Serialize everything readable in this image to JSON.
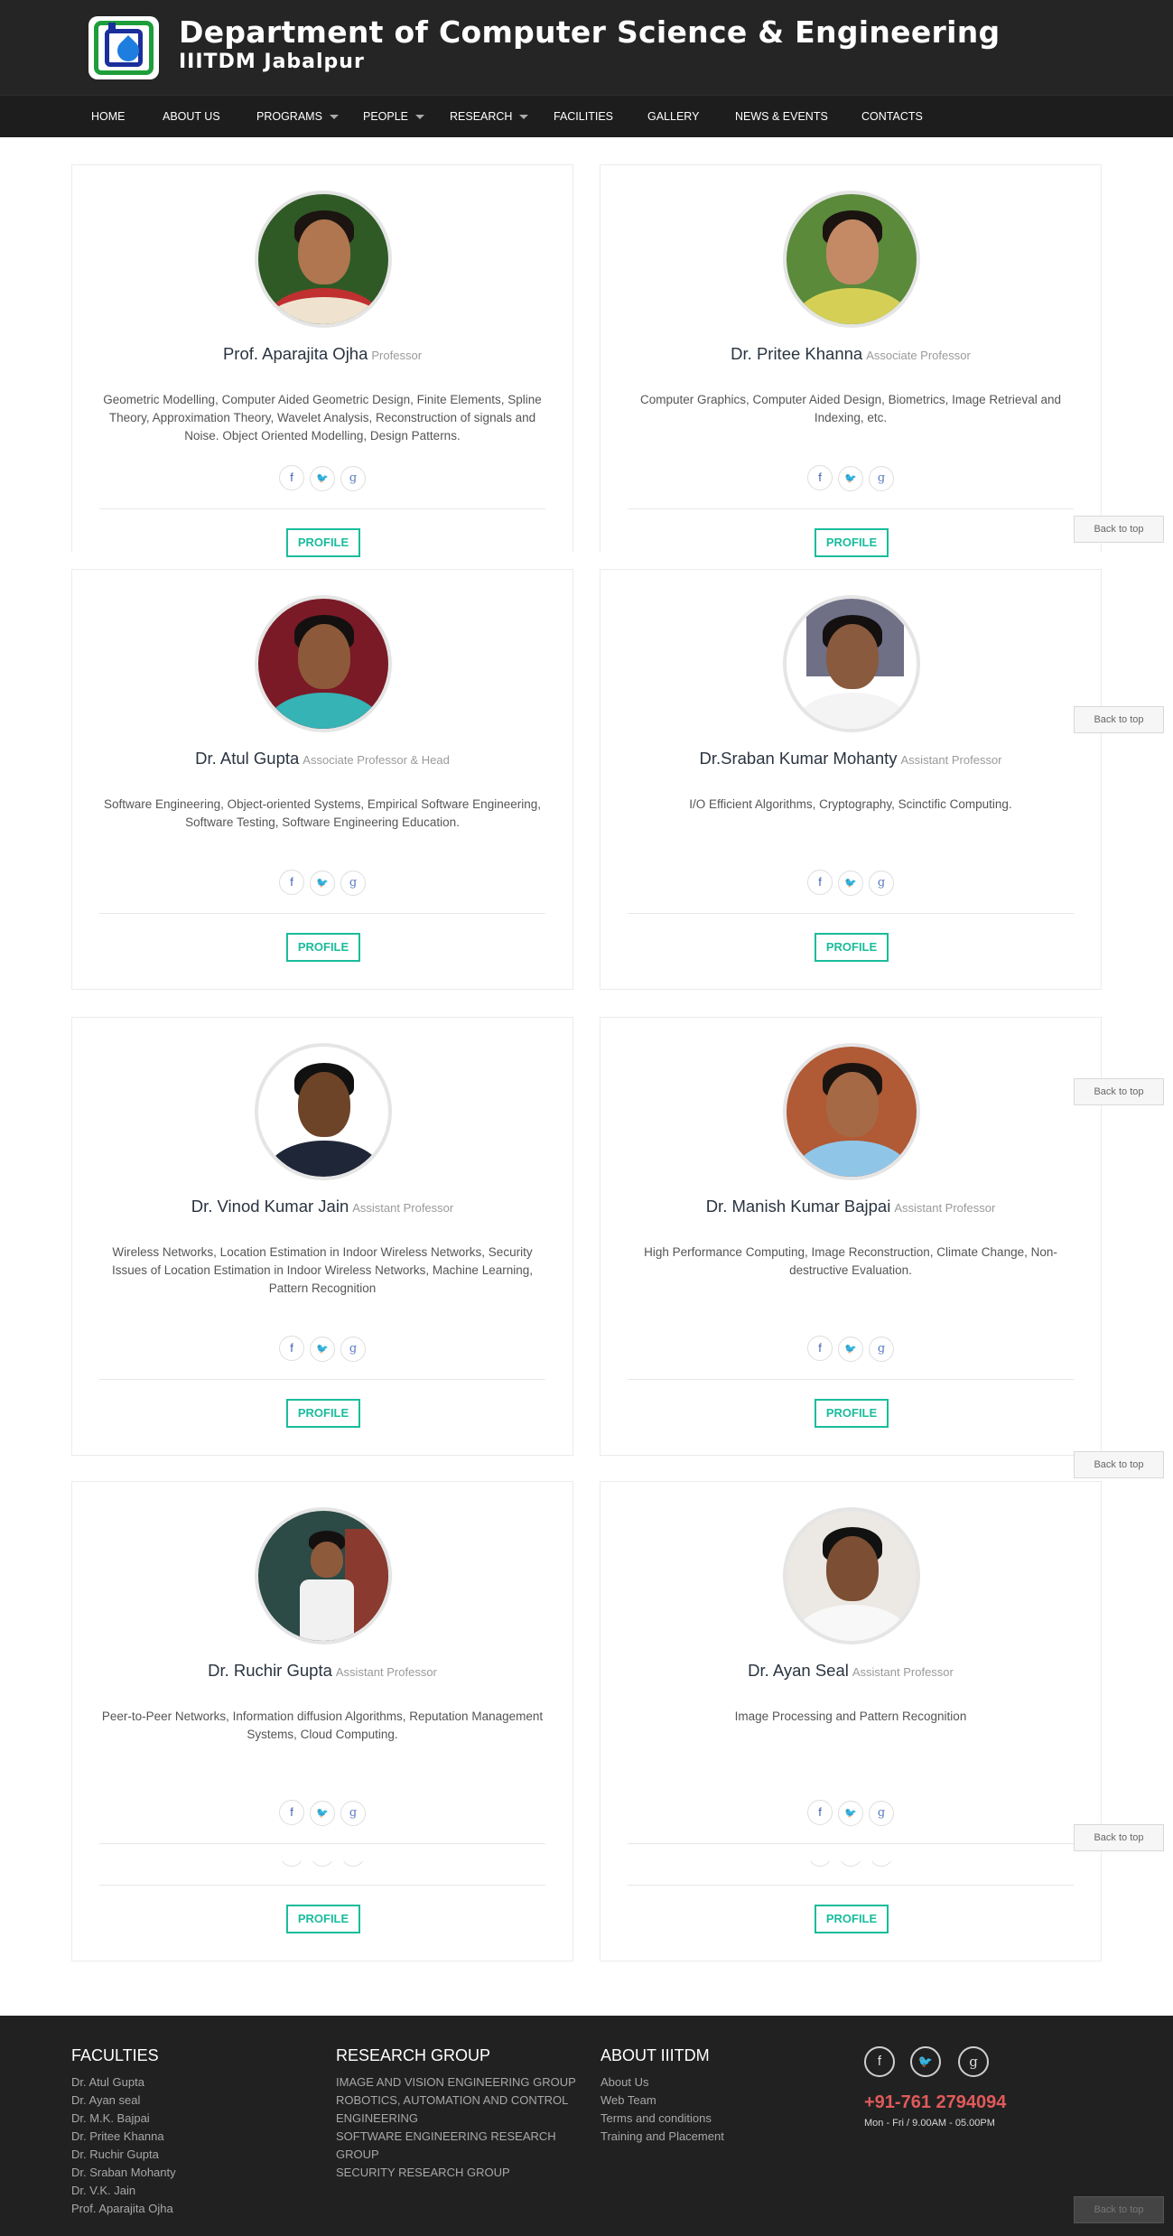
{
  "header": {
    "title": "Department of Computer Science & Engineering",
    "subtitle": "IIITDM Jabalpur"
  },
  "nav": {
    "items": [
      {
        "label": "HOME"
      },
      {
        "label": "ABOUT US"
      },
      {
        "label": "PROGRAMS",
        "dropdown": true
      },
      {
        "label": "PEOPLE",
        "dropdown": true
      },
      {
        "label": "RESEARCH",
        "dropdown": true
      },
      {
        "label": "FACILITIES"
      },
      {
        "label": "GALLERY"
      },
      {
        "label": "NEWS & EVENTS"
      },
      {
        "label": "CONTACTS"
      }
    ]
  },
  "faculty": [
    {
      "name": "Prof. Aparajita Ojha",
      "role": "Professor",
      "interests": "Geometric Modelling, Computer Aided Geometric Design, Finite Elements, Spline Theory, Approximation Theory, Wavelet Analysis, Reconstruction of signals and Noise. Object Oriented Modelling, Design Patterns."
    },
    {
      "name": "Dr. Pritee Khanna",
      "role": "Associate Professor",
      "interests": "Computer Graphics, Computer Aided Design, Biometrics, Image Retrieval and Indexing, etc."
    },
    {
      "name": "Dr. Atul Gupta",
      "role": "Associate Professor & Head",
      "interests": "Software Engineering, Object-oriented Systems, Empirical Software Engineering, Software Testing, Software Engineering Education."
    },
    {
      "name": "Dr.Sraban Kumar Mohanty",
      "role": "Assistant Professor",
      "interests": "I/O Efficient Algorithms, Cryptography, Scinctific Computing."
    },
    {
      "name": "Dr. Vinod Kumar Jain",
      "role": "Assistant Professor",
      "interests": "Wireless Networks, Location Estimation in Indoor Wireless Networks, Security Issues of Location Estimation in Indoor Wireless Networks, Machine Learning, Pattern Recognition"
    },
    {
      "name": "Dr. Manish Kumar Bajpai",
      "role": "Assistant Professor",
      "interests": "High Performance Computing, Image Reconstruction, Climate Change, Non-destructive Evaluation."
    },
    {
      "name": "Dr. Ruchir Gupta",
      "role": "Assistant Professor",
      "interests": "Peer-to-Peer Networks, Information diffusion Algorithms, Reputation Management Systems, Cloud Computing."
    },
    {
      "name": "Dr. Ayan Seal",
      "role": "Assistant Professor",
      "interests": "Image Processing and Pattern Recognition"
    }
  ],
  "social_icons": {
    "facebook": "f",
    "twitter": "🐦",
    "google": "g"
  },
  "buttons": {
    "profile": "PROFILE",
    "back_to_top": "Back to top"
  },
  "footer": {
    "faculties": {
      "heading": "FACULTIES",
      "items": [
        "Dr. Atul Gupta",
        "Dr. Ayan seal",
        "Dr. M.K. Bajpai",
        "Dr. Pritee Khanna",
        "Dr. Ruchir Gupta",
        "Dr. Sraban Mohanty",
        "Dr. V.K. Jain",
        "Prof. Aparajita Ojha"
      ]
    },
    "research": {
      "heading": "RESEARCH GROUP",
      "items": [
        "IMAGE AND VISION ENGINEERING GROUP",
        "ROBOTICS, AUTOMATION AND CONTROL ENGINEERING",
        "SOFTWARE ENGINEERING RESEARCH GROUP",
        "SECURITY RESEARCH GROUP"
      ]
    },
    "about": {
      "heading": "ABOUT IIITDM",
      "items": [
        "About Us",
        "Web Team",
        "Terms and conditions",
        "Training and Placement"
      ]
    },
    "contact": {
      "phone": "+91-761 2794094",
      "hours": "Mon - Fri / 9.00AM - 05.00PM"
    }
  },
  "colors": {
    "accent": "#1abc9c",
    "header_bg": "#252525",
    "phone": "#e05a5a"
  }
}
